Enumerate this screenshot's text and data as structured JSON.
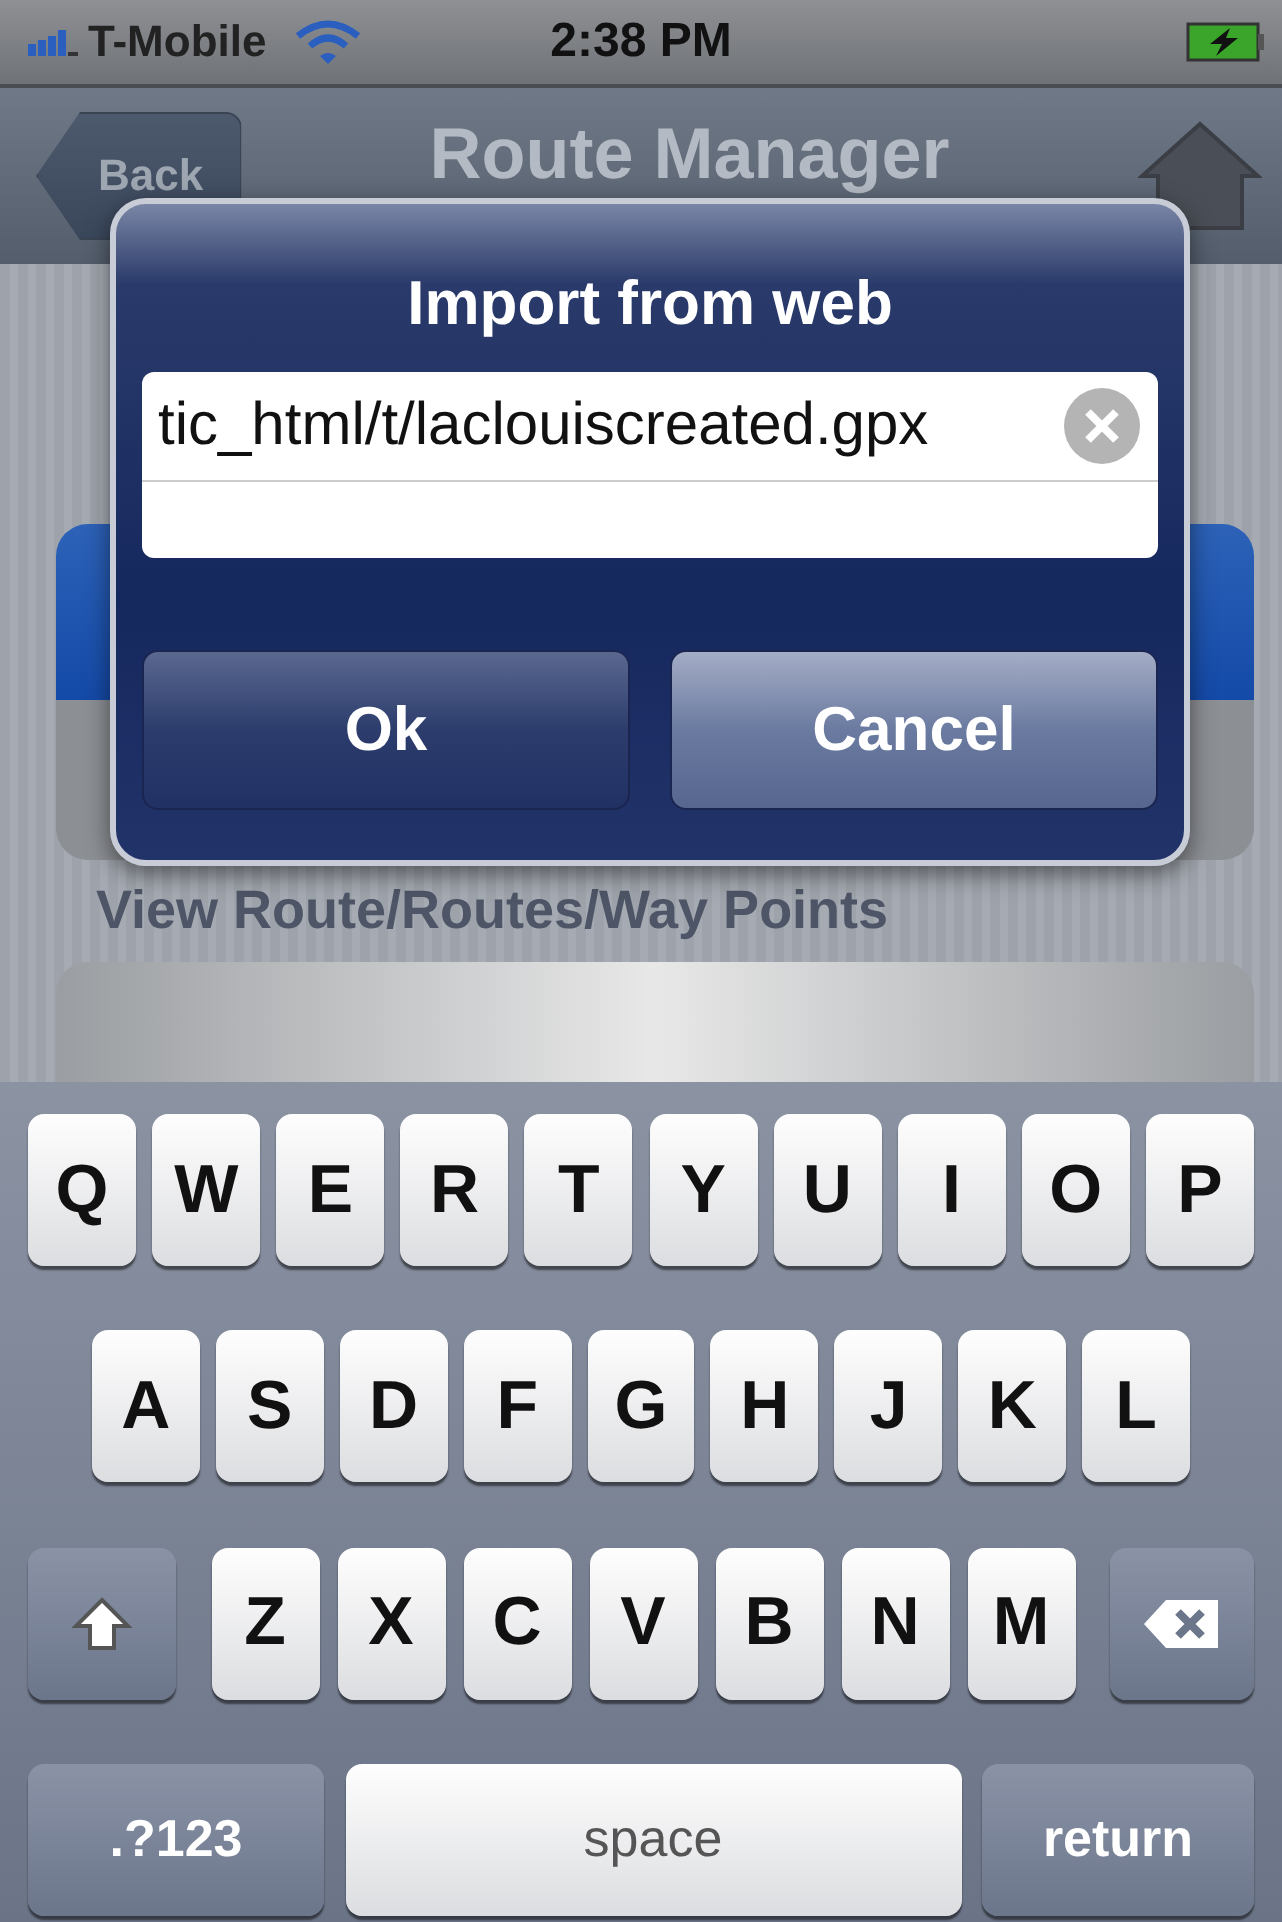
{
  "status_bar": {
    "carrier": "T-Mobile",
    "time": "2:38 PM"
  },
  "nav_bar": {
    "back": "Back",
    "title": "Route Manager"
  },
  "list": {
    "section_header": "View Route/Routes/Way Points"
  },
  "dialog": {
    "title": "Import from web",
    "field_value": "tic_html/t/laclouiscreated.gpx",
    "buttons": [
      "Ok",
      "Cancel"
    ]
  },
  "keyboard": {
    "letter_rows": [
      {
        "kind": "plain",
        "keys": [
          "Q",
          "W",
          "E",
          "R",
          "T",
          "Y",
          "U",
          "I",
          "O",
          "P"
        ]
      },
      {
        "kind": "plain",
        "keys": [
          "A",
          "S",
          "D",
          "F",
          "G",
          "H",
          "J",
          "K",
          "L"
        ]
      },
      {
        "kind": "with_modifiers",
        "keys": [
          "Z",
          "X",
          "C",
          "V",
          "B",
          "N",
          "M"
        ]
      }
    ],
    "bottom_keys": [
      {
        "kind": "mode",
        "label": ".?123"
      },
      {
        "kind": "space",
        "label": "space"
      },
      {
        "kind": "return",
        "label": "return"
      }
    ]
  }
}
